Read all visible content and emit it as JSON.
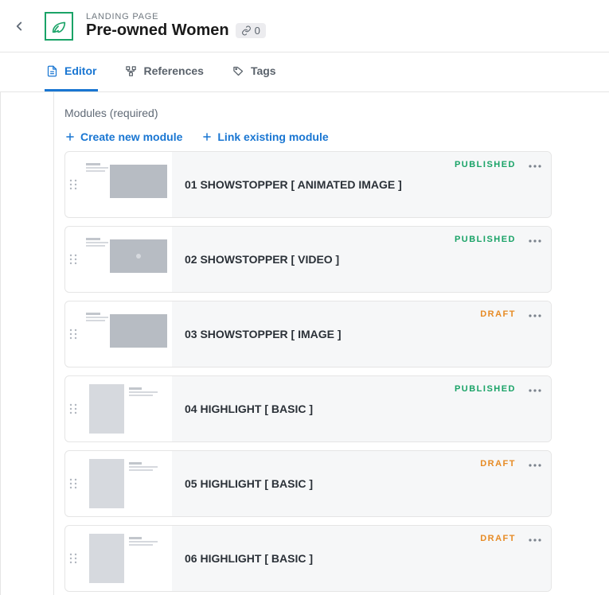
{
  "header": {
    "eyebrow": "LANDING PAGE",
    "title": "Pre-owned Women",
    "link_count": "0"
  },
  "tabs": {
    "editor": "Editor",
    "references": "References",
    "tags": "Tags"
  },
  "section": {
    "label": "Modules (required)",
    "create": "Create new module",
    "link": "Link existing module"
  },
  "statuses": {
    "published": "PUBLISHED",
    "draft": "DRAFT"
  },
  "modules": [
    {
      "title": "01 SHOWSTOPPER [ ANIMATED IMAGE ]",
      "status": "published",
      "kind": "showstopper",
      "play": false
    },
    {
      "title": "02 SHOWSTOPPER [ VIDEO ]",
      "status": "published",
      "kind": "showstopper",
      "play": true
    },
    {
      "title": "03 SHOWSTOPPER [ IMAGE ]",
      "status": "draft",
      "kind": "showstopper",
      "play": false
    },
    {
      "title": "04 HIGHLIGHT [ BASIC ]",
      "status": "published",
      "kind": "highlight"
    },
    {
      "title": "05 HIGHLIGHT [ BASIC ]",
      "status": "draft",
      "kind": "highlight"
    },
    {
      "title": "06 HIGHLIGHT [ BASIC ]",
      "status": "draft",
      "kind": "highlight"
    }
  ]
}
